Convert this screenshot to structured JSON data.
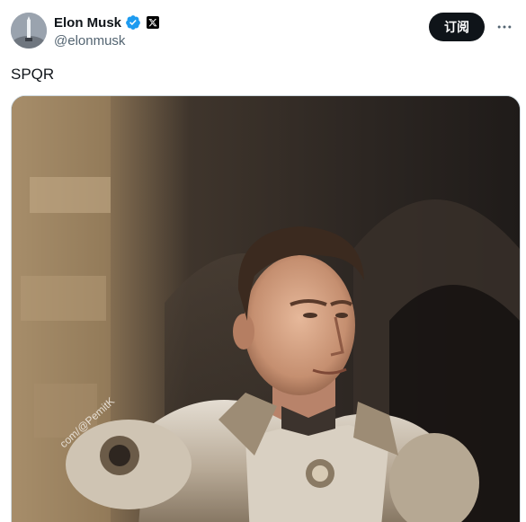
{
  "tweet": {
    "author": {
      "display_name": "Elon Musk",
      "handle": "@elonmusk",
      "verified_icon": "verified-badge-icon",
      "affiliate_icon": "x-logo-icon",
      "avatar_icon": "avatar"
    },
    "subscribe_label": "订阅",
    "more_icon": "more-options-icon",
    "text": "SPQR",
    "media": {
      "kind": "image",
      "watermark": "com/@PemitK"
    }
  },
  "colors": {
    "text_primary": "#0f1419",
    "text_secondary": "#536471",
    "verified_blue": "#1d9bf0",
    "button_bg": "#0f1419",
    "border": "#cfd9de"
  }
}
